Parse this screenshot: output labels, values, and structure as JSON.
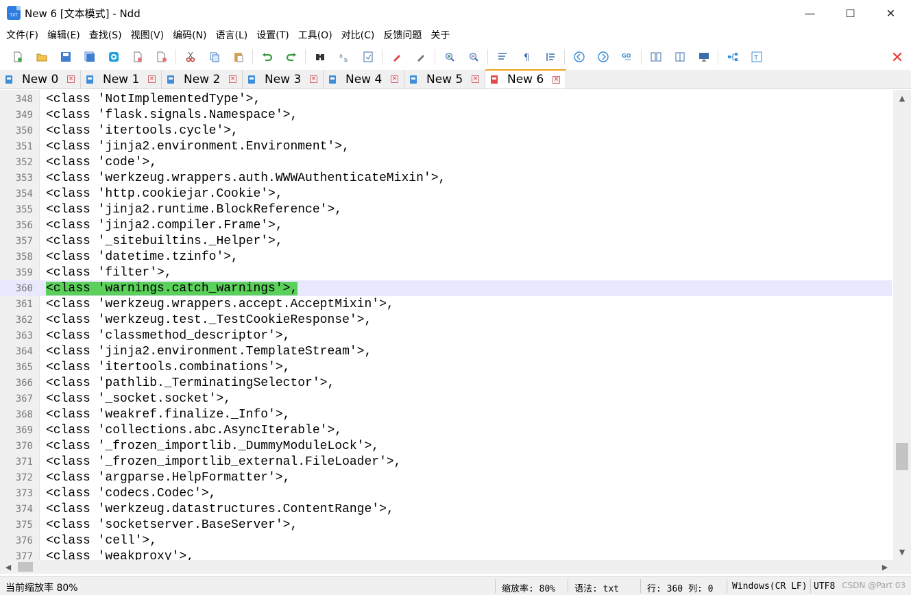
{
  "window": {
    "title": "New 6 [文本模式] - Ndd",
    "icon_label": "TXT",
    "controls": {
      "minimize": "—",
      "maximize": "☐",
      "close": "✕"
    }
  },
  "menu": [
    "文件(F)",
    "编辑(E)",
    "查找(S)",
    "视图(V)",
    "编码(N)",
    "语言(L)",
    "设置(T)",
    "工具(O)",
    "对比(C)",
    "反馈问题",
    "关于"
  ],
  "toolbar": {
    "icons": [
      "new-file-icon",
      "open-file-icon",
      "save-icon",
      "save-all-icon",
      "reload-icon",
      "close-file-icon",
      "close-all-icon",
      "cut-icon",
      "copy-icon",
      "paste-icon",
      "undo-icon",
      "redo-icon",
      "find-icon",
      "replace-icon",
      "mark-icon",
      "highlight-icon",
      "clear-icon",
      "zoom-in-icon",
      "zoom-out-icon",
      "word-wrap-icon",
      "show-symbols-icon",
      "indent-guide-icon",
      "prev-icon",
      "next-icon",
      "goto-icon",
      "compare-icon",
      "split-icon",
      "monitor-icon",
      "tree-icon",
      "text-icon",
      "close-x-icon"
    ],
    "close_glyph": "✕"
  },
  "tabs": [
    {
      "label": "New 0",
      "active": false
    },
    {
      "label": "New 1",
      "active": false
    },
    {
      "label": "New 2",
      "active": false
    },
    {
      "label": "New 3",
      "active": false
    },
    {
      "label": "New 4",
      "active": false
    },
    {
      "label": "New 5",
      "active": false
    },
    {
      "label": "New 6",
      "active": true
    }
  ],
  "tab_close_glyph": "×",
  "editor": {
    "current_line": 360,
    "lines": [
      {
        "n": "348",
        "text": "<class 'NotImplementedType'>,"
      },
      {
        "n": "349",
        "text": "<class 'flask.signals.Namespace'>,"
      },
      {
        "n": "350",
        "text": "<class 'itertools.cycle'>,"
      },
      {
        "n": "351",
        "text": "<class 'jinja2.environment.Environment'>,"
      },
      {
        "n": "352",
        "text": "<class 'code'>,"
      },
      {
        "n": "353",
        "text": "<class 'werkzeug.wrappers.auth.WWWAuthenticateMixin'>,"
      },
      {
        "n": "354",
        "text": "<class 'http.cookiejar.Cookie'>,"
      },
      {
        "n": "355",
        "text": "<class 'jinja2.runtime.BlockReference'>,"
      },
      {
        "n": "356",
        "text": "<class 'jinja2.compiler.Frame'>,"
      },
      {
        "n": "357",
        "text": "<class '_sitebuiltins._Helper'>,"
      },
      {
        "n": "358",
        "text": "<class 'datetime.tzinfo'>,"
      },
      {
        "n": "359",
        "text": "<class 'filter'>,"
      },
      {
        "n": "360",
        "text": "<class 'warnings.catch_warnings'>,"
      },
      {
        "n": "361",
        "text": "<class 'werkzeug.wrappers.accept.AcceptMixin'>,"
      },
      {
        "n": "362",
        "text": "<class 'werkzeug.test._TestCookieResponse'>,"
      },
      {
        "n": "363",
        "text": "<class 'classmethod_descriptor'>,"
      },
      {
        "n": "364",
        "text": "<class 'jinja2.environment.TemplateStream'>,"
      },
      {
        "n": "365",
        "text": "<class 'itertools.combinations'>,"
      },
      {
        "n": "366",
        "text": "<class 'pathlib._TerminatingSelector'>,"
      },
      {
        "n": "367",
        "text": "<class '_socket.socket'>,"
      },
      {
        "n": "368",
        "text": "<class 'weakref.finalize._Info'>,"
      },
      {
        "n": "369",
        "text": "<class 'collections.abc.AsyncIterable'>,"
      },
      {
        "n": "370",
        "text": "<class '_frozen_importlib._DummyModuleLock'>,"
      },
      {
        "n": "371",
        "text": "<class '_frozen_importlib_external.FileLoader'>,"
      },
      {
        "n": "372",
        "text": "<class 'argparse.HelpFormatter'>,"
      },
      {
        "n": "373",
        "text": "<class 'codecs.Codec'>,"
      },
      {
        "n": "374",
        "text": "<class 'werkzeug.datastructures.ContentRange'>,"
      },
      {
        "n": "375",
        "text": "<class 'socketserver.BaseServer'>,"
      },
      {
        "n": "376",
        "text": "<class 'cell'>,"
      },
      {
        "n": "377",
        "text": "<class 'weakproxy'>,"
      }
    ]
  },
  "scroll": {
    "up": "▲",
    "down": "▼",
    "left": "◀",
    "right": "▶"
  },
  "status": {
    "zoom_left": "当前缩放率 80%",
    "zoom": "缩放率: 80%",
    "syntax": "语法: txt",
    "position": "行: 360 列: 0",
    "eol": "Windows(CR LF)",
    "encoding": "UTF8",
    "watermark": "CSDN @Part 03"
  }
}
